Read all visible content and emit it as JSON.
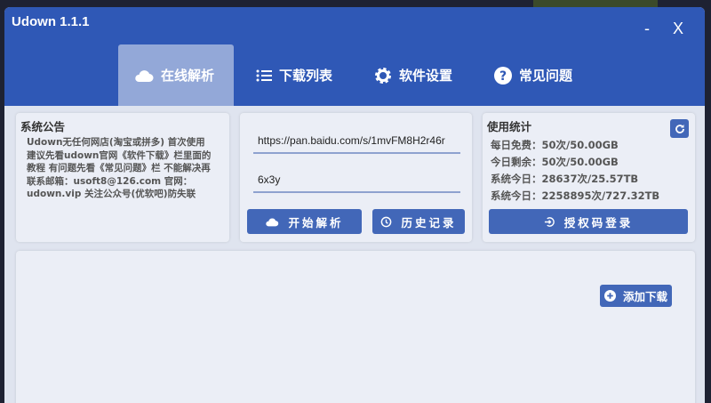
{
  "window": {
    "title": "Udown 1.1.1",
    "minimize": "-",
    "close": "X"
  },
  "tabs": [
    {
      "label": "在线解析",
      "icon": "cloud-icon",
      "active": true
    },
    {
      "label": "下载列表",
      "icon": "list-icon"
    },
    {
      "label": "软件设置",
      "icon": "gear-icon"
    },
    {
      "label": "常见问题",
      "icon": "question-icon"
    }
  ],
  "notice": {
    "title": "系统公告",
    "text": "Udown无任何网店(淘宝或拼多) 首次使用建议先看udown官网《软件下载》栏里面的教程 有问题先看《常见问题》栏 不能解决再联系邮箱：usoft8@126.com 官网：udown.vip 关注公众号(优软吧)防失联"
  },
  "parse": {
    "url": "https://pan.baidu.com/s/1mvFM8H2r46r",
    "code": "6x3y",
    "start_label": "开始解析",
    "history_label": "历史记录"
  },
  "stats": {
    "title": "使用统计",
    "lines": [
      "每日免费：50次/50.00GB",
      "今日剩余：50次/50.00GB",
      "系统今日：28637次/25.57TB",
      "系统今日：2258895次/727.32TB"
    ],
    "login_label": "授权码登录"
  },
  "downloads": {
    "add_label": "添加下载"
  },
  "colors": {
    "header": "#2f58b6",
    "button": "#4267b8",
    "active_tab": "#93a8d8"
  }
}
